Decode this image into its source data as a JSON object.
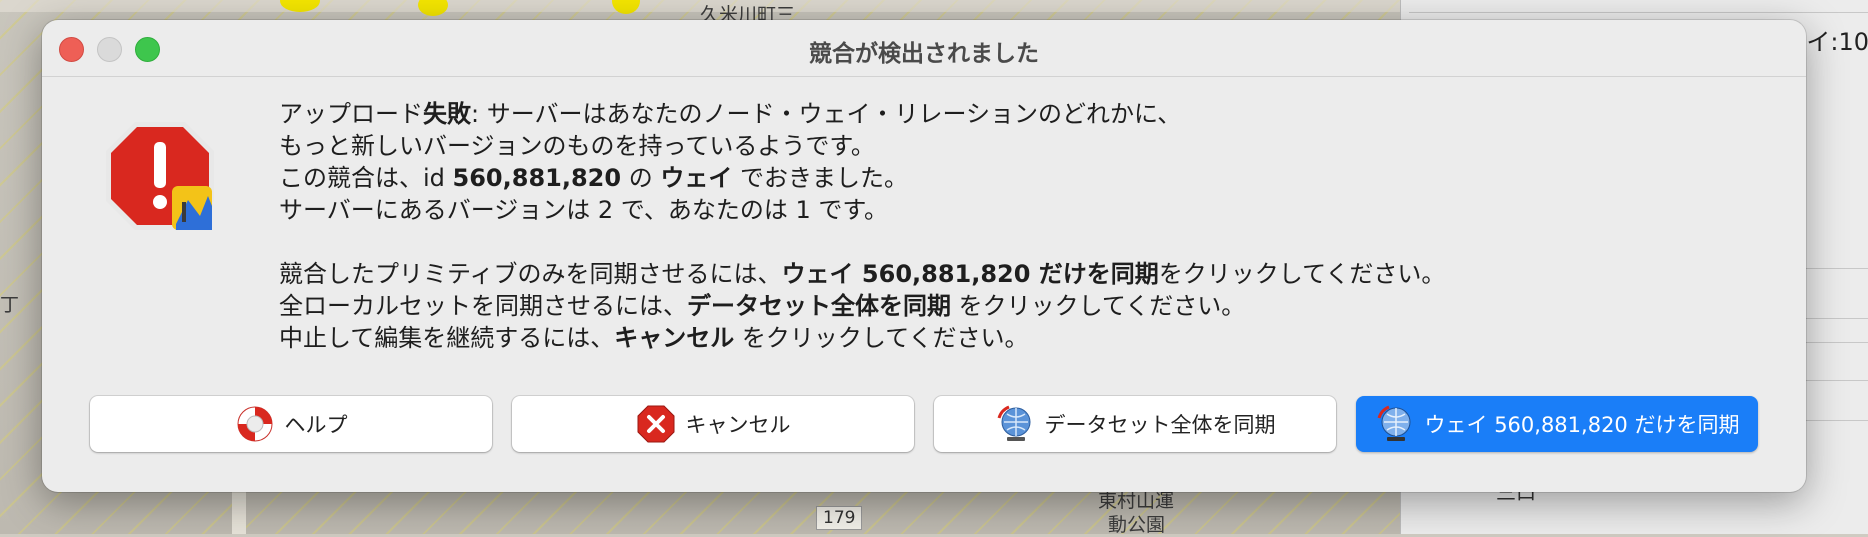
{
  "background_map": {
    "labels": [
      "久米川町三",
      "丁",
      "179",
      "東村山運",
      "動公園",
      "三口"
    ],
    "side_fragment": "イ:10"
  },
  "dialog": {
    "title": "競合が検出されました",
    "message": {
      "line1_pre": "アップロード",
      "line1_bold": "失敗",
      "line1_post": ": サーバーはあなたのノード・ウェイ・リレーションのどれかに、",
      "line2": "もっと新しいバージョンのものを持っているようです。",
      "line3_pre": "この競合は、id ",
      "line3_id": "560,881,820",
      "line3_mid": " の ",
      "line3_type": "ウェイ",
      "line3_post": " でおきました。",
      "line4": "サーバーにあるバージョンは 2 で、あなたのは 1 です。",
      "line5_pre": "競合したプリミティブのみを同期させるには、",
      "line5_bold": "ウェイ 560,881,820 だけを同期",
      "line5_post": "をクリックしてください。",
      "line6_pre": "全ローカルセットを同期させるには、",
      "line6_bold": "データセット全体を同期",
      "line6_post": " をクリックしてください。",
      "line7_pre": "中止して編集を継続するには、",
      "line7_bold": "キャンセル",
      "line7_post": " をクリックしてください。"
    },
    "buttons": {
      "help": "ヘルプ",
      "cancel": "キャンセル",
      "sync_dataset": "データセット全体を同期",
      "sync_way": "ウェイ 560,881,820 だけを同期"
    },
    "icons": {
      "alert": "error-stop-icon",
      "help": "lifebuoy-icon",
      "cancel": "cancel-x-icon",
      "sync": "globe-sync-icon"
    },
    "colors": {
      "primary_button": "#1a7ef8",
      "close_traffic": "#ee5f56",
      "max_traffic": "#3ec64d",
      "alert_red": "#d9281f"
    }
  }
}
